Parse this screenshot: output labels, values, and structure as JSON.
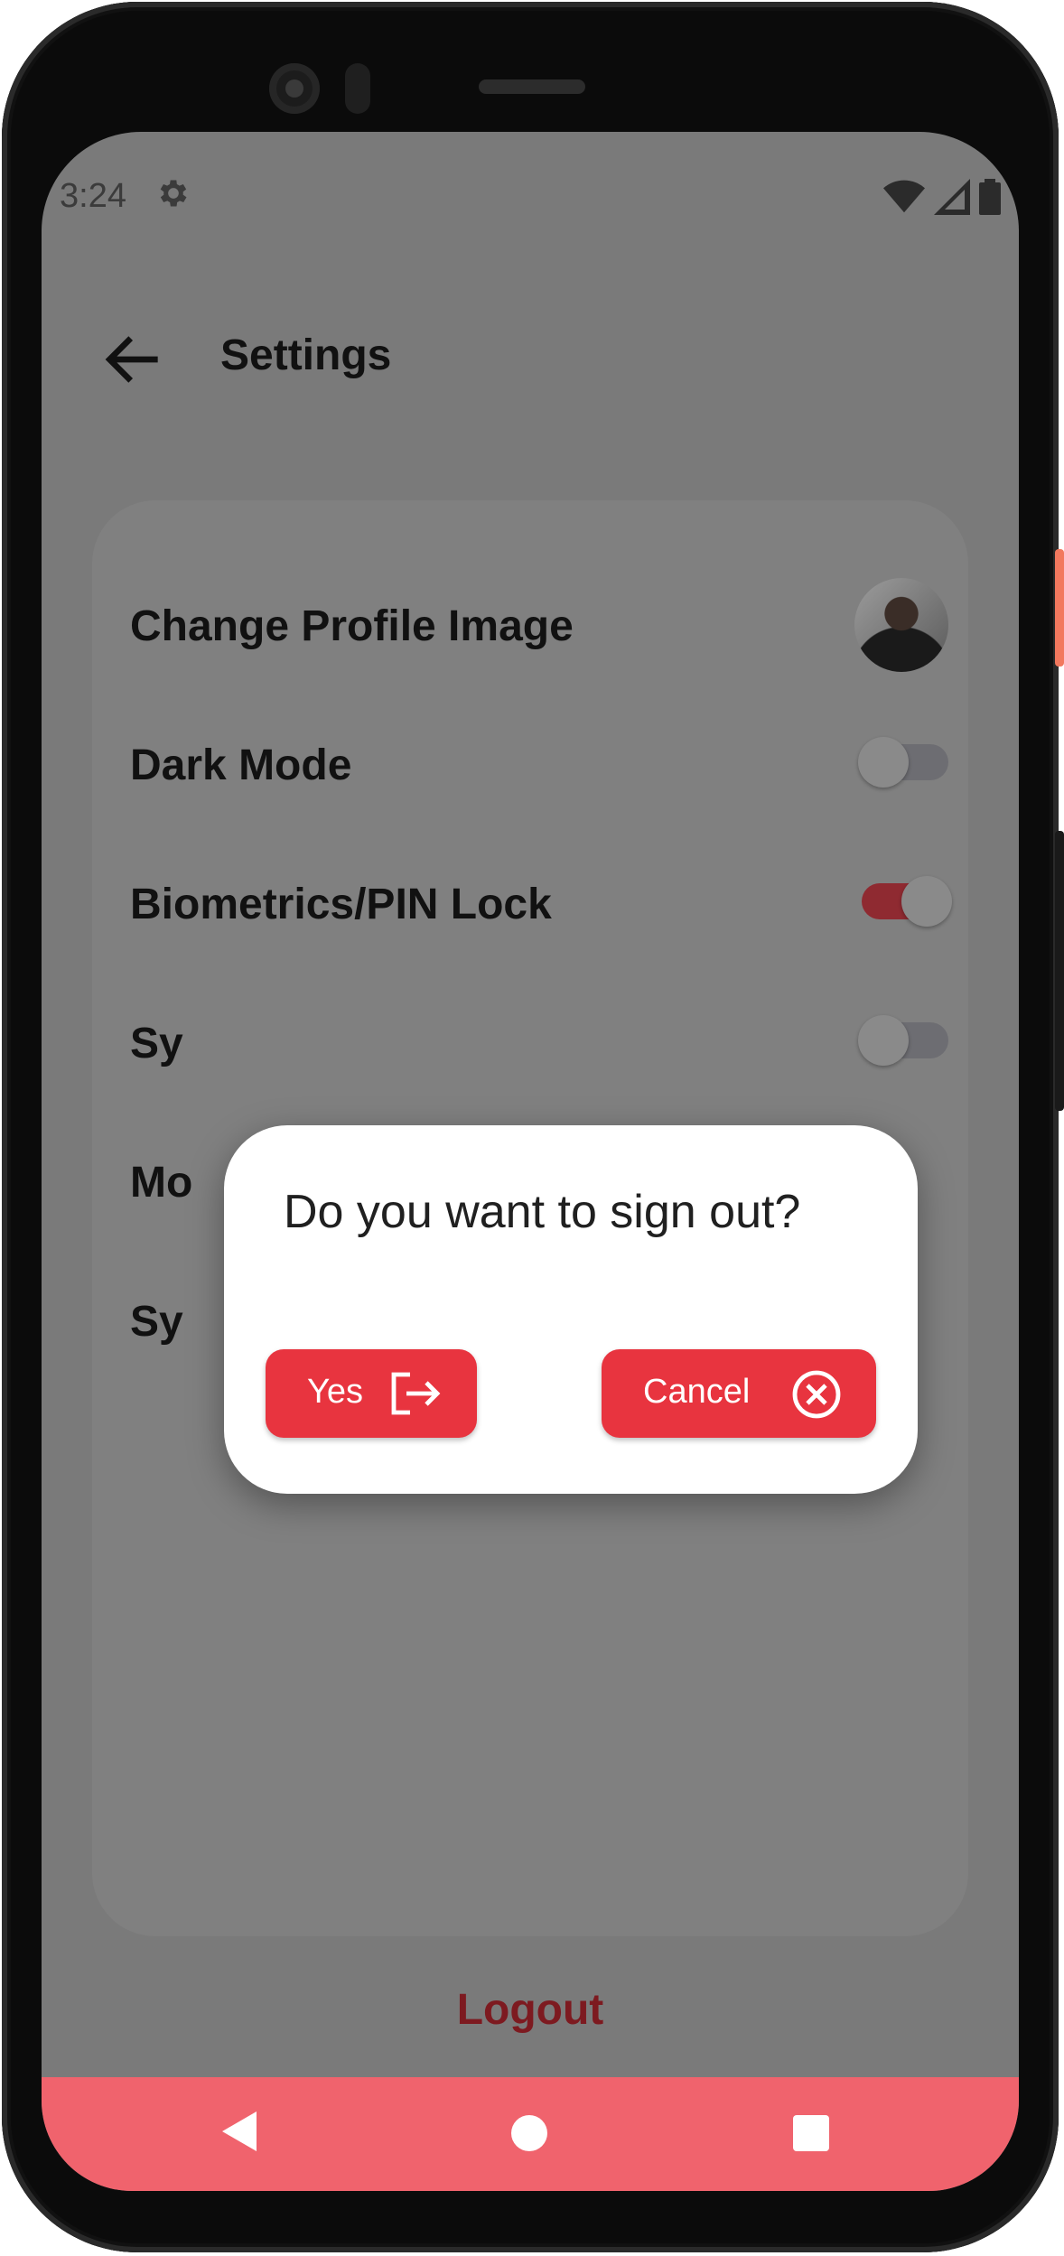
{
  "status_bar": {
    "time": "3:24"
  },
  "header": {
    "title": "Settings"
  },
  "settings": {
    "rows": [
      {
        "label": "Change Profile Image"
      },
      {
        "label": "Dark Mode"
      },
      {
        "label": "Biometrics/PIN Lock"
      },
      {
        "label": "Sy"
      },
      {
        "label": "Mo"
      },
      {
        "label": "Sy"
      }
    ],
    "toggles": {
      "dark_mode": false,
      "biometrics_pin_lock": true,
      "sync": false
    }
  },
  "logout": {
    "label": "Logout"
  },
  "dialog": {
    "message": "Do you want to sign out?",
    "yes_label": "Yes",
    "cancel_label": "Cancel"
  },
  "colors": {
    "accent": "#e8343f",
    "nav_bar": "#f0636d",
    "logout_text": "#7d1a20",
    "scrim_background": "#7a7a7a"
  }
}
